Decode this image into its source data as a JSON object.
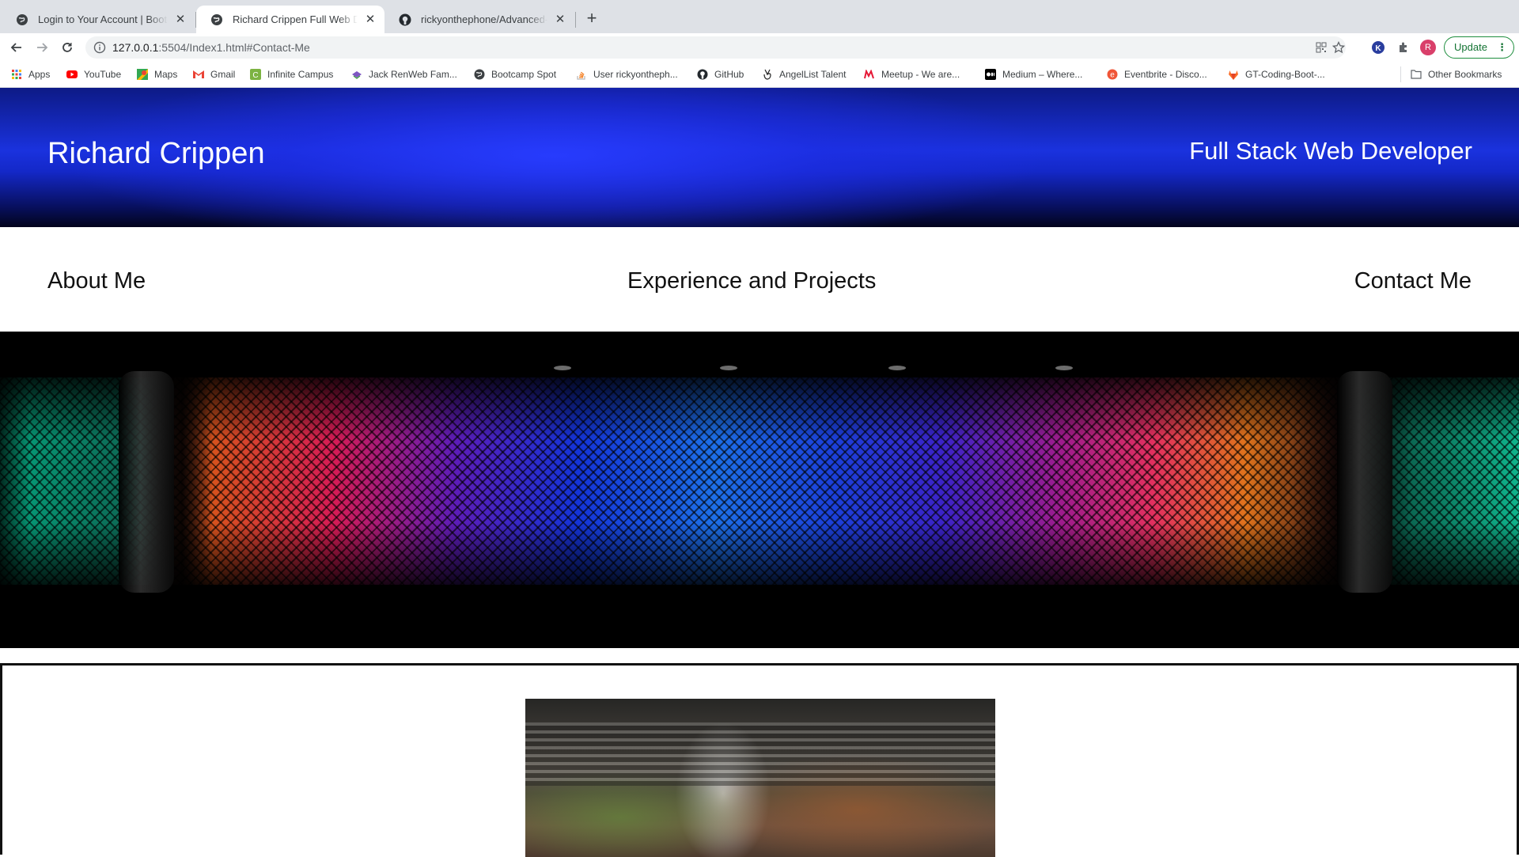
{
  "browser": {
    "tabs": [
      {
        "title": "Login to Your Account | Bootcamp Spot",
        "active": false
      },
      {
        "title": "Richard Crippen Full Web Developer",
        "active": true
      },
      {
        "title": "rickyonthephone/Advanced-CSS",
        "active": false
      }
    ],
    "url_host": "127.0.0.1",
    "url_rest": ":5504/Index1.html#Contact-Me",
    "profile_initial": "R",
    "update_label": "Update",
    "bookmarks": [
      {
        "label": "Apps",
        "icon": "apps-grid-icon"
      },
      {
        "label": "YouTube",
        "icon": "youtube-icon"
      },
      {
        "label": "Maps",
        "icon": "maps-icon"
      },
      {
        "label": "Gmail",
        "icon": "gmail-icon"
      },
      {
        "label": "Infinite Campus",
        "icon": "infinite-campus-icon"
      },
      {
        "label": "Jack RenWeb Fam...",
        "icon": "renweb-icon"
      },
      {
        "label": "Bootcamp Spot",
        "icon": "globe-icon"
      },
      {
        "label": "User rickyontheph...",
        "icon": "stackoverflow-icon"
      },
      {
        "label": "GitHub",
        "icon": "github-icon"
      },
      {
        "label": "AngelList Talent",
        "icon": "angellist-icon"
      },
      {
        "label": "Meetup - We are...",
        "icon": "meetup-icon"
      },
      {
        "label": "Medium – Where...",
        "icon": "medium-icon"
      },
      {
        "label": "Eventbrite - Disco...",
        "icon": "eventbrite-icon"
      },
      {
        "label": "GT-Coding-Boot-...",
        "icon": "gitlab-icon"
      }
    ],
    "other_bookmarks": "Other Bookmarks"
  },
  "page": {
    "site_name": "Richard Crippen",
    "site_role": "Full Stack Web Developer",
    "nav": {
      "about": "About Me",
      "experience": "Experience and Projects",
      "contact": "Contact Me"
    }
  },
  "colors": {
    "header_blue": "#1a32de",
    "update_green": "#137333",
    "profile_pink": "#d93f6a"
  }
}
